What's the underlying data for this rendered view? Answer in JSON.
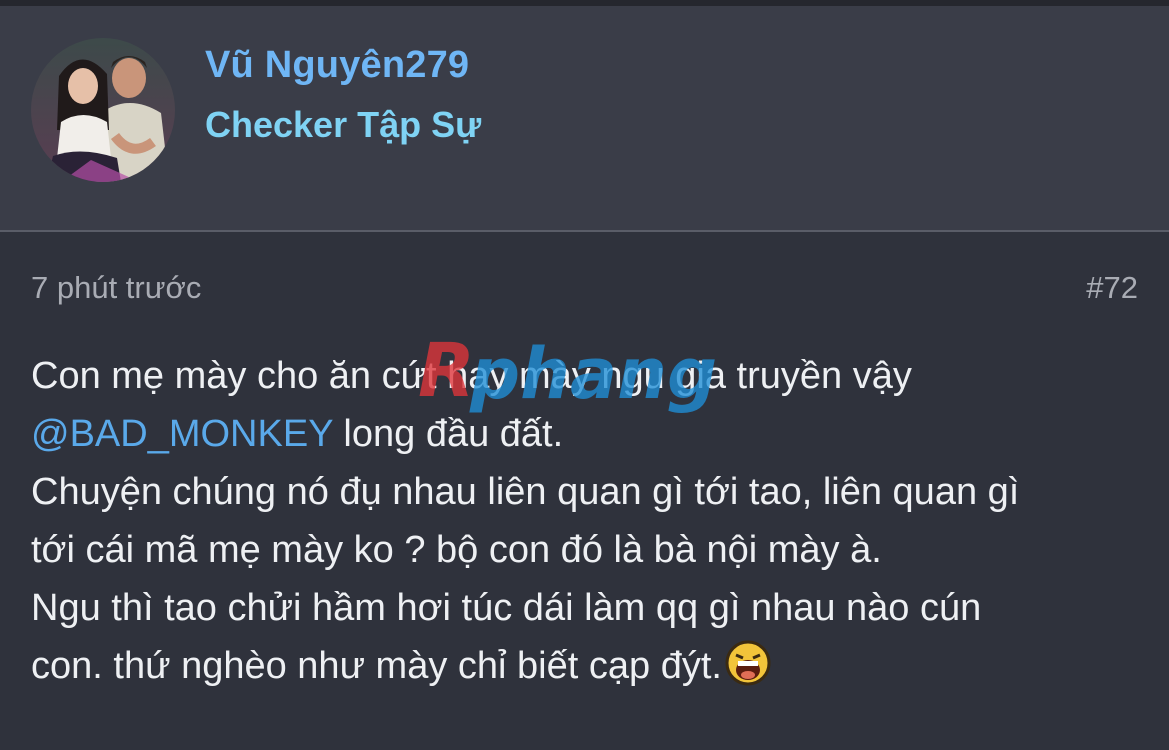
{
  "user": {
    "name": "Vũ Nguyên279",
    "title": "Checker Tập Sự",
    "avatar": "avatar-photo"
  },
  "post": {
    "timestamp": "7 phút trước",
    "number": "#72",
    "lines": [
      "Con mẹ mày cho ăn cứt hay mày ngu gia truyền vậy",
      "Chuyện chúng nó đụ nhau liên quan gì tới tao, liên quan gì",
      "tới cái mã mẹ mày ko ? bộ con đó là bà nội mày à.",
      "Ngu thì tao chửi hầm hơi túc dái làm qq gì nhau nào cún",
      "con. thứ nghèo như mày chỉ biết cạp đýt."
    ],
    "mention": "@BAD_MONKEY",
    "mention_suffix": " long đầu đất.",
    "emoji": "laughing-emoji"
  },
  "watermark": {
    "text": "phang",
    "mark": "R"
  },
  "colors": {
    "background": "#2f323c",
    "header_background": "#3a3d48",
    "username": "#6fb6f5",
    "user_title": "#7fd3f4",
    "mention": "#5aa9ea",
    "body_text": "#eef0f3",
    "muted_text": "#a9acb4"
  }
}
